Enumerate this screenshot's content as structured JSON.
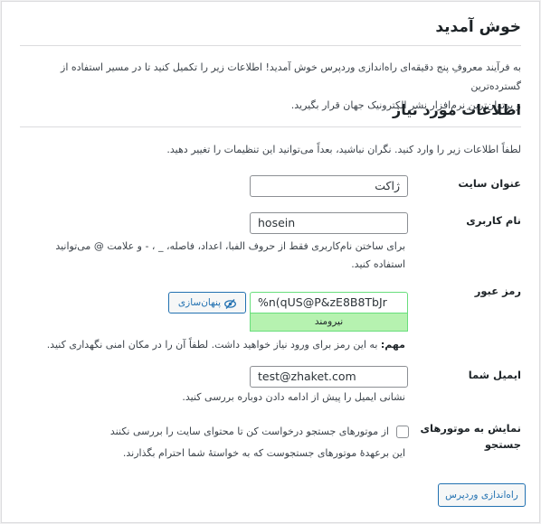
{
  "welcome": {
    "title": "خوش آمدید",
    "intro_line1": "به فرآیند معروفِ پنج دقیقه‌ای راه‌اندازی وردپرس خوش آمدید! اطلاعات زیر را تکمیل کنید تا در مسیر استفاده از گسترده‌ترین",
    "intro_line2": "و پرتوان‌ترین نرم‌افزار نشر الکترونیک جهان قرار بگیرید."
  },
  "required": {
    "title": "اطلاعات مورد نیاز",
    "description": "لطفاً اطلاعات زیر را وارد کنید. نگران نباشید، بعداً می‌توانید این تنظیمات را تغییر دهید."
  },
  "form": {
    "site_title": {
      "label": "عنوان سایت",
      "value": "ژاکت"
    },
    "username": {
      "label": "نام کاربری",
      "value": "hosein",
      "help_line1": "برای ساختن نام‌کاربری فقط از حروف الفبا، اعداد، فاصله، _ ، - و علامت @ می‌توانید",
      "help_line2": "استفاده کنید."
    },
    "password": {
      "label": "رمز عبور",
      "value": "%n(qUS@P&zE8B8TbJr",
      "hide_button": "پنهان‌سازی",
      "strength": "نیرومند",
      "important_label": "مهم:",
      "important_text": "به این رمز برای ورود نیاز خواهید داشت. لطفاً آن را در مکان امنی نگهداری کنید."
    },
    "email": {
      "label": "ایمیل شما",
      "value": "test@zhaket.com",
      "help": "نشانی ایمیل را پیش از ادامه دادن دوباره بررسی کنید."
    },
    "search_visibility": {
      "label_line1": "نمایش به موتورهای",
      "label_line2": "جستجو",
      "checkbox_label": "از موتورهای جستجو درخواست کن تا محتوای سایت را بررسی نکنند",
      "help": "این برعهدهٔ موتورهای جستجوست که به خواستهٔ شما احترام بگذارند.",
      "checked": false
    },
    "submit": "راه‌اندازی وردپرس"
  },
  "colors": {
    "accent": "#2271b1",
    "strength_bg": "#b6f2b0",
    "strength_border": "#68de7c"
  }
}
